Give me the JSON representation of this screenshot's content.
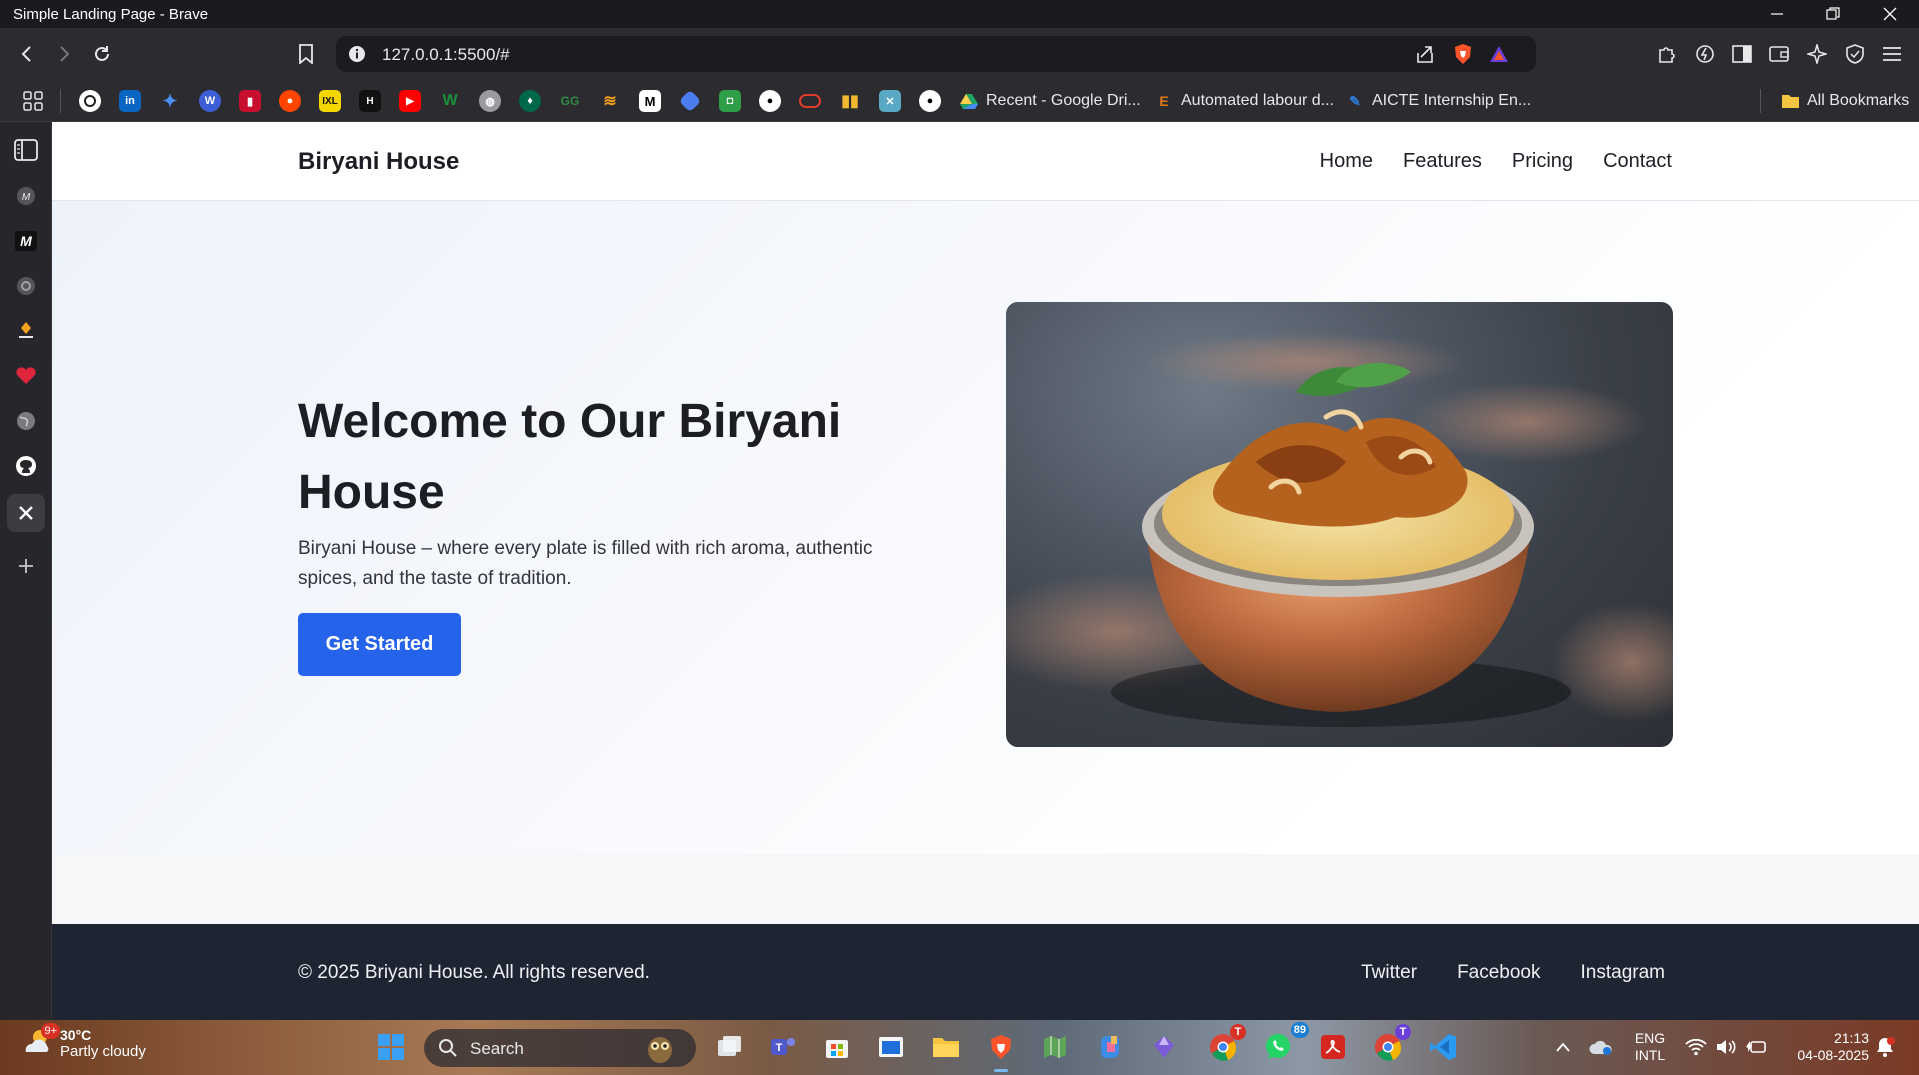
{
  "window": {
    "title": "Simple Landing Page - Brave"
  },
  "toolbar": {
    "url": "127.0.0.1:5500/#"
  },
  "bookmarks": {
    "recent_drive": "Recent - Google Dri...",
    "automated_labour": "Automated labour d...",
    "aicte": "AICTE Internship En...",
    "all_bookmarks": "All Bookmarks"
  },
  "site": {
    "brand": "Biryani House",
    "nav": [
      "Home",
      "Features",
      "Pricing",
      "Contact"
    ],
    "hero": {
      "title": "Welcome to Our Biryani House",
      "subtitle": "Biryani House – where every plate is filled with rich aroma, authentic spices, and the taste of tradition.",
      "cta": "Get Started"
    },
    "footer": {
      "copyright": "© 2025 Briyani House. All rights reserved.",
      "links": [
        "Twitter",
        "Facebook",
        "Instagram"
      ]
    }
  },
  "taskbar": {
    "weather_temp": "30°C",
    "weather_desc": "Partly cloudy",
    "weather_badge": "9+",
    "search_placeholder": "Search",
    "whatsapp_badge": "89",
    "chrome_badge_1": "T",
    "chrome_badge_2": "T",
    "lang_1": "ENG",
    "lang_2": "INTL",
    "time": "21:13",
    "date": "04-08-2025"
  }
}
